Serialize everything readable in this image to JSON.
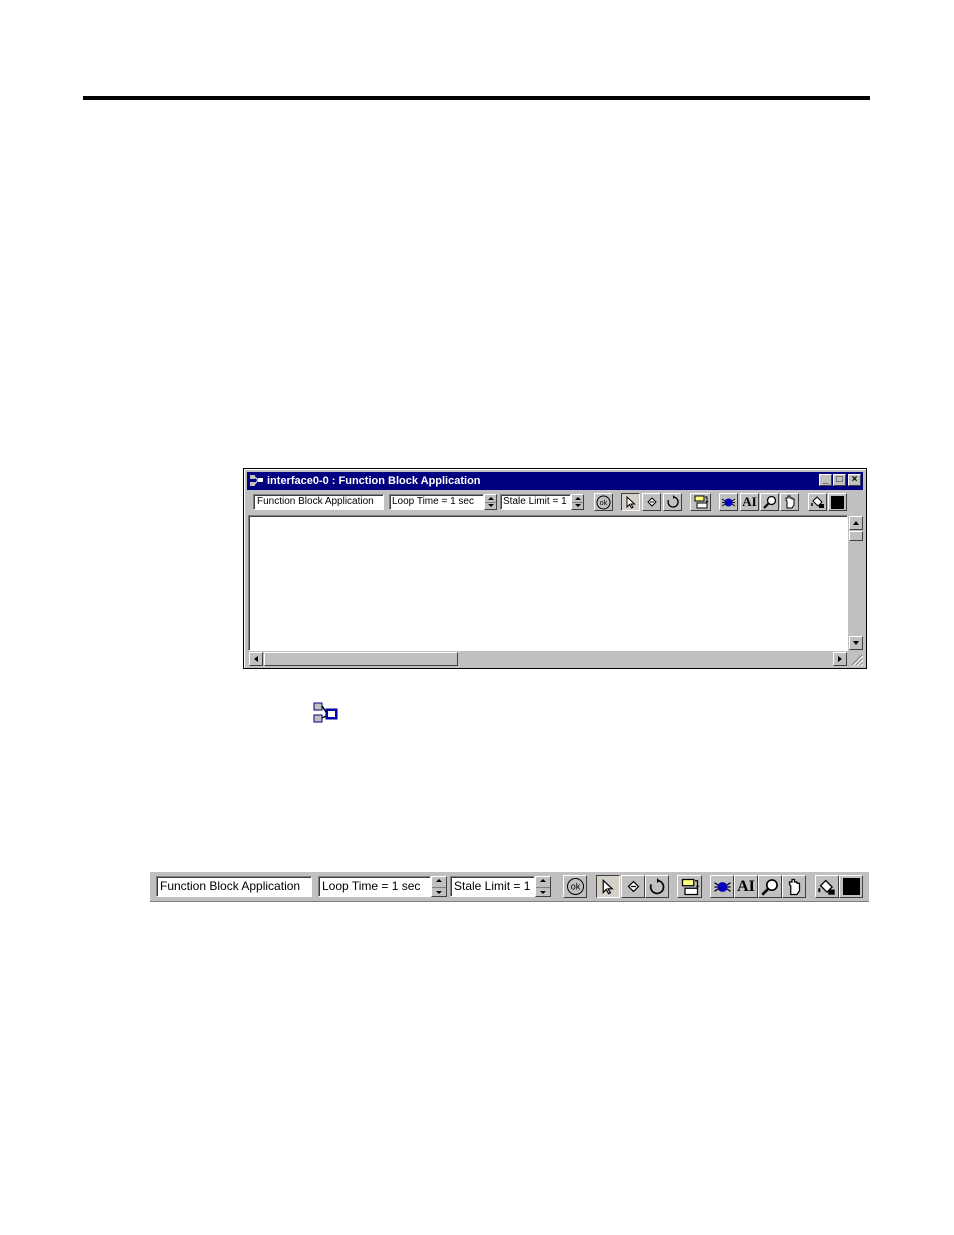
{
  "window": {
    "title": "interface0-0 : Function Block Application",
    "min_label": "_",
    "max_label": "□",
    "close_label": "×"
  },
  "toolbar": {
    "app_field": "Function Block Application",
    "loop_time": "Loop Time = 1 sec",
    "stale_limit": "Stale Limit = 1",
    "ok_label": "ok",
    "text_tool_label": "AI"
  },
  "colors": {
    "titlebar": "#000080",
    "face": "#c0c0c0",
    "accent_blue": "#0000c0"
  }
}
